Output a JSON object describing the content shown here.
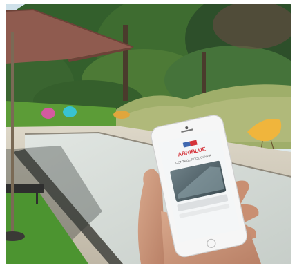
{
  "scene": {
    "description_tag": "outdoor pool cover scene with smartphone app",
    "sky_color": "#d9e6f0",
    "foliage_dark": "#2f5a2a",
    "foliage_mid": "#4f7d35",
    "grass_color": "#5b9a34",
    "umbrella_color": "#8f5b4f",
    "deck_color": "#d8d2c2",
    "cover_color": "#d8dedb",
    "coping_color": "#bdb6a8",
    "chair_orange": "#f0b53c",
    "chair_cyan": "#38c3d0",
    "chair_pink": "#d45aa0"
  },
  "phone": {
    "brand_text": "ABRIBLUE",
    "tagline_text": "CONTROL POOL COVER",
    "image_card_label": "",
    "button_label": "",
    "screen_bg": "#f4f6f7",
    "brand_color": "#d5333a",
    "frame_color": "#f6f6f6"
  }
}
